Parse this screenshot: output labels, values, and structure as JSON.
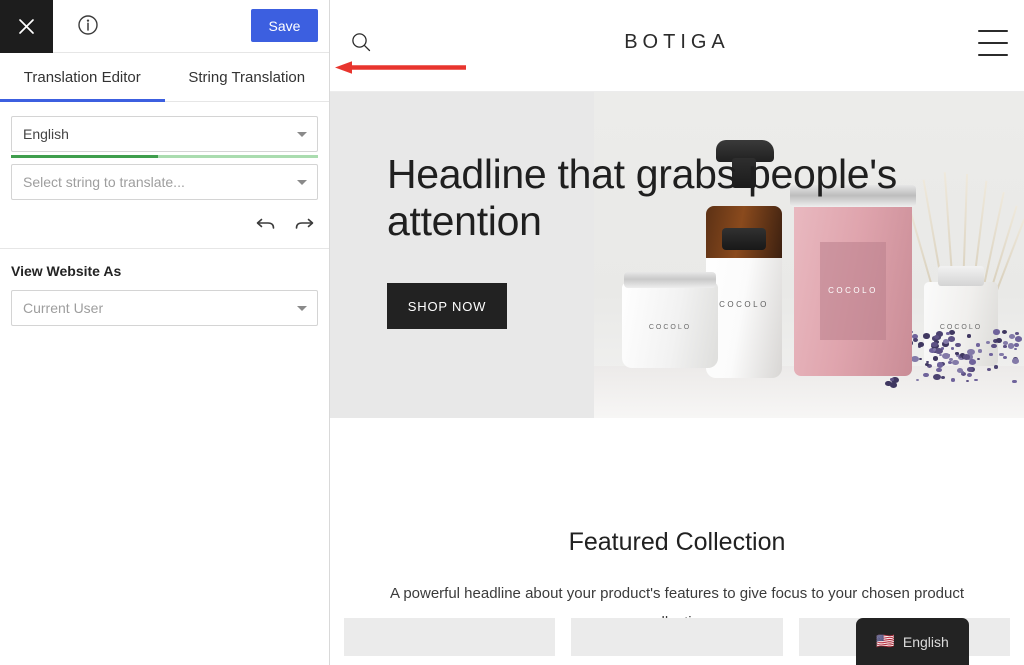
{
  "sidebar": {
    "topbar": {
      "close_icon": "close-icon",
      "info_icon": "info-circle-icon",
      "save_label": "Save"
    },
    "tabs": [
      {
        "label": "Translation Editor",
        "active": true
      },
      {
        "label": "String Translation",
        "active": false
      }
    ],
    "language_select": {
      "value": "English",
      "caret_icon": "chevron-down-icon",
      "progress_percent": 48,
      "progress_fill_color": "#3f9e4d",
      "progress_track_color": "#aadcaf"
    },
    "string_select": {
      "placeholder": "Select string to translate...",
      "value": "",
      "caret_icon": "chevron-down-icon"
    },
    "history": {
      "undo_icon": "undo-arrow-icon",
      "redo_icon": "redo-arrow-icon"
    },
    "view_website_as": {
      "label": "View Website As",
      "value": "Current User",
      "caret_icon": "chevron-down-icon"
    }
  },
  "preview": {
    "site_header": {
      "search_icon": "search-icon",
      "logo": "BOTIGA",
      "menu_icon": "hamburger-menu-icon"
    },
    "hero": {
      "headline": "Headline that grabs people's attention",
      "cta_label": "SHOP NOW",
      "background_color": "#e8e8e8",
      "product_labels": [
        "COCOLO",
        "COCOLO",
        "COCOLO",
        "COCOLO"
      ]
    },
    "featured": {
      "title": "Featured Collection",
      "subtitle": "A powerful headline about your product's features to give focus to your chosen product collection",
      "card_count": 3
    },
    "language_switcher": {
      "flag": "🇺🇸",
      "label": "English",
      "background_color": "#232323"
    }
  },
  "annotation": {
    "arrow_color": "#e8352e",
    "arrow_direction": "left"
  },
  "colors": {
    "accent_blue": "#3c5fe0",
    "dark": "#1d1d1d",
    "hero_gray": "#e8e8e8"
  }
}
